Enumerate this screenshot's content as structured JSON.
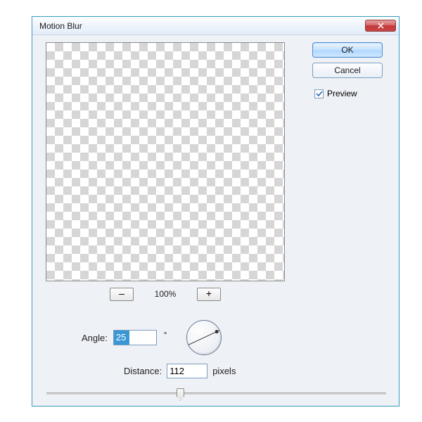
{
  "dialog": {
    "title": "Motion Blur"
  },
  "buttons": {
    "ok": "OK",
    "cancel": "Cancel"
  },
  "preview": {
    "label": "Preview",
    "checked": true
  },
  "zoom": {
    "minus": "–",
    "level": "100%",
    "plus": "+"
  },
  "angle": {
    "label": "Angle:",
    "value": "25",
    "unit": "°"
  },
  "distance": {
    "label": "Distance:",
    "value": "112",
    "unit": "pixels"
  }
}
